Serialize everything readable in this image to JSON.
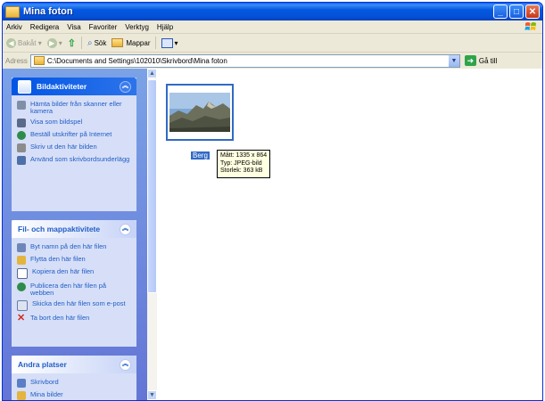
{
  "window": {
    "title": "Mina foton"
  },
  "menu": [
    "Arkiv",
    "Redigera",
    "Visa",
    "Favoriter",
    "Verktyg",
    "Hjälp"
  ],
  "toolbar": {
    "back": "Bakåt",
    "search": "Sök",
    "folders": "Mappar"
  },
  "address": {
    "label": "Adress",
    "path": "C:\\Documents and Settings\\102010\\Skrivbord\\Mina foton",
    "go": "Gå till"
  },
  "panels": {
    "picture_tasks": {
      "title": "Bildaktiviteter",
      "items": [
        "Hämta bilder från skanner eller kamera",
        "Visa som bildspel",
        "Beställ utskrifter på Internet",
        "Skriv ut den här bilden",
        "Använd som skrivbordsunderlägg"
      ]
    },
    "file_tasks": {
      "title": "Fil- och mappaktivitete",
      "items": [
        "Byt namn på den här filen",
        "Flytta den här filen",
        "Kopiera den här filen",
        "Publicera den här filen på webben",
        "Skicka den här filen som e-post",
        "Ta bort den här filen"
      ]
    },
    "other_places": {
      "title": "Andra platser",
      "items": [
        "Skrivbord",
        "Mina bilder"
      ]
    }
  },
  "file": {
    "name": "Berg",
    "tooltip": {
      "dimensions": "Mått: 1335 x 864",
      "type": "Typ: JPEG-bild",
      "size": "Storlek: 363 kB"
    }
  },
  "colors": {
    "titlebar": "#0458E0",
    "selection": "#316AC5",
    "tooltip_bg": "#FFFFE1",
    "link": "#215DC6"
  }
}
